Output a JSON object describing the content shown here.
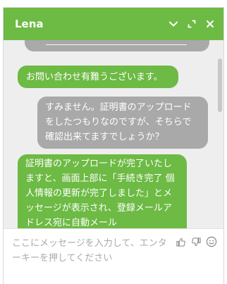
{
  "header": {
    "agent_name": "Lena"
  },
  "messages": [
    {
      "role": "agent",
      "text": "お問い合わせ有難うございます。"
    },
    {
      "role": "user",
      "text": "すみません。証明書のアップロードをしたつもりなのですが、そちらで確認出来てますでしょうか？"
    },
    {
      "role": "agent",
      "text": "証明書のアップロードが完了いたしますと、画面上部に「手続き完了 個人情報の更新が完了しました」とメッセージが表示され、登録メールアドレス宛に自動メール"
    }
  ],
  "composer": {
    "placeholder": "ここにメッセージを入力して、エンターキーを押してください"
  },
  "colors": {
    "brand": "#6dba44",
    "user_bubble": "#a9a9a9",
    "chat_background": "#eeeeee"
  },
  "icons": {
    "minimize": "chevron-down-icon",
    "popout": "popout-icon",
    "close": "close-icon",
    "thumbs_up": "thumbs-up-icon",
    "thumbs_down": "thumbs-down-icon",
    "emoji": "smiley-icon"
  }
}
